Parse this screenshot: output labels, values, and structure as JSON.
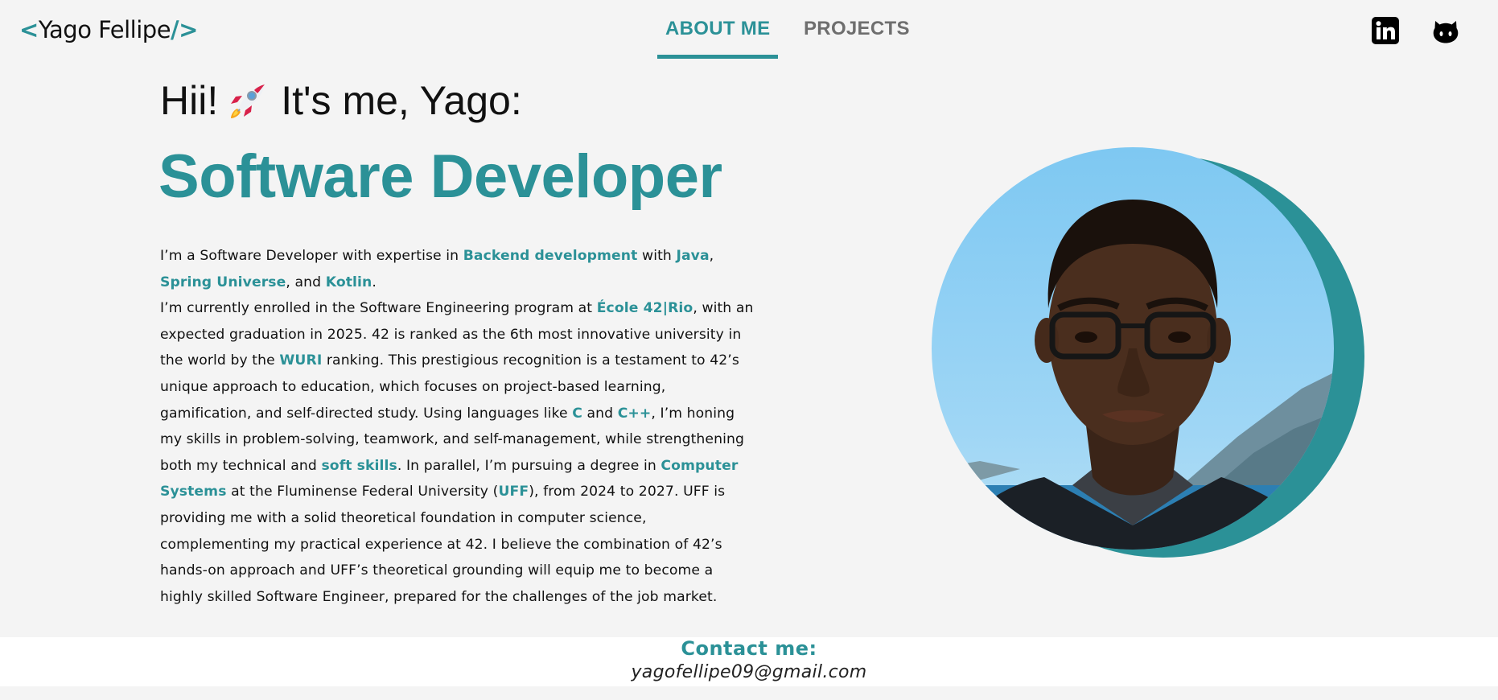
{
  "header": {
    "logo": {
      "open": "<",
      "name": "Yago Fellipe",
      "close": "/>"
    },
    "nav": [
      {
        "label": "ABOUT ME",
        "active": true
      },
      {
        "label": "PROJECTS",
        "active": false
      }
    ],
    "social": [
      {
        "icon": "linkedin-icon"
      },
      {
        "icon": "github-icon"
      }
    ]
  },
  "hero": {
    "greeting_start": "Hii!",
    "greeting_end": "It's me, Yago:",
    "role": "Software Developer",
    "bio": [
      {
        "t": "I’m a Software Developer with expertise in "
      },
      {
        "t": "Backend development",
        "h": true
      },
      {
        "t": " with "
      },
      {
        "t": "Java",
        "h": true
      },
      {
        "t": ", "
      },
      {
        "t": "Spring Universe",
        "h": true
      },
      {
        "t": ", and "
      },
      {
        "t": "Kotlin",
        "h": true
      },
      {
        "t": ".",
        "br": true
      },
      {
        "t": "I’m currently enrolled in the Software Engineering program at "
      },
      {
        "t": "École 42|Rio",
        "h": true
      },
      {
        "t": ", with an expected graduation in 2025. 42 is ranked as the 6th most innovative university in the world by the "
      },
      {
        "t": "WURI",
        "h": true
      },
      {
        "t": " ranking. This prestigious recognition is a testament to 42’s unique approach to education, which focuses on project-based learning, gamification, and self-directed study. Using languages like "
      },
      {
        "t": "C",
        "h": true
      },
      {
        "t": " and "
      },
      {
        "t": "C++",
        "h": true
      },
      {
        "t": ", I’m honing my skills in problem-solving, teamwork, and self-management, while strengthening both my technical and "
      },
      {
        "t": "soft skills",
        "h": true
      },
      {
        "t": ". In parallel, I’m pursuing a degree in "
      },
      {
        "t": "Computer Systems",
        "h": true
      },
      {
        "t": " at the Fluminense Federal University ("
      },
      {
        "t": "UFF",
        "h": true
      },
      {
        "t": "), from 2024 to 2027. UFF is providing me with a solid theoretical foundation in computer science, complementing my practical experience at 42. I believe the combination of 42’s hands-on approach and UFF’s theoretical grounding will equip me to become a highly skilled Software Engineer, prepared for the challenges of the job market."
      }
    ]
  },
  "footer": {
    "contact_title": "Contact me:",
    "email": "yagofellipe09@gmail.com"
  },
  "colors": {
    "accent": "#2b9197",
    "background": "#f4f4f4",
    "nav_inactive": "#6e6e6e",
    "text": "#111111"
  }
}
